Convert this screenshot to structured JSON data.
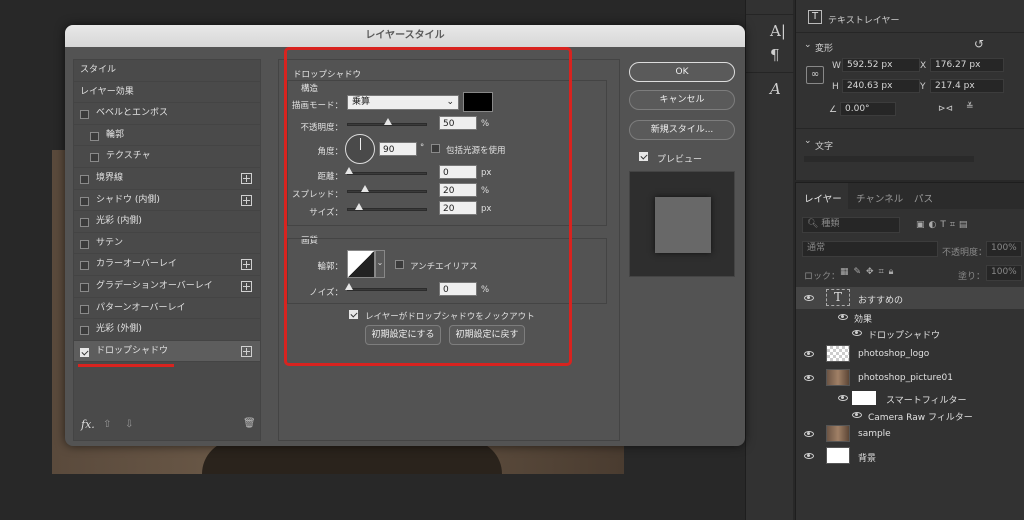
{
  "dialog": {
    "title": "レイヤースタイル",
    "styles": [
      {
        "label": "スタイル",
        "checkbox": false,
        "plus": false,
        "indent": false
      },
      {
        "label": "レイヤー効果",
        "checkbox": false,
        "plus": false,
        "indent": false
      },
      {
        "label": "ベベルとエンボス",
        "checkbox": true,
        "checked": false,
        "plus": false,
        "indent": false
      },
      {
        "label": "輪郭",
        "checkbox": true,
        "checked": false,
        "plus": false,
        "indent": true
      },
      {
        "label": "テクスチャ",
        "checkbox": true,
        "checked": false,
        "plus": false,
        "indent": true
      },
      {
        "label": "境界線",
        "checkbox": true,
        "checked": false,
        "plus": true,
        "indent": false
      },
      {
        "label": "シャドウ (内側)",
        "checkbox": true,
        "checked": false,
        "plus": true,
        "indent": false
      },
      {
        "label": "光彩 (内側)",
        "checkbox": true,
        "checked": false,
        "plus": false,
        "indent": false
      },
      {
        "label": "サテン",
        "checkbox": true,
        "checked": false,
        "plus": false,
        "indent": false
      },
      {
        "label": "カラーオーバーレイ",
        "checkbox": true,
        "checked": false,
        "plus": true,
        "indent": false
      },
      {
        "label": "グラデーションオーバーレイ",
        "checkbox": true,
        "checked": false,
        "plus": true,
        "indent": false
      },
      {
        "label": "パターンオーバーレイ",
        "checkbox": true,
        "checked": false,
        "plus": false,
        "indent": false
      },
      {
        "label": "光彩 (外側)",
        "checkbox": true,
        "checked": false,
        "plus": false,
        "indent": false
      },
      {
        "label": "ドロップシャドウ",
        "checkbox": true,
        "checked": true,
        "plus": true,
        "indent": false,
        "selected": true
      }
    ],
    "footer_fx": "fx.",
    "section_title": "ドロップシャドウ",
    "structure": {
      "title": "構造",
      "blend_mode_label": "描画モード：",
      "blend_mode_value": "乗算",
      "color": "#000000",
      "opacity_label": "不透明度：",
      "opacity_value": "50",
      "opacity_unit": "%",
      "angle_label": "角度：",
      "angle_value": "90",
      "angle_unit": "°",
      "global_light_label": "包括光源を使用",
      "distance_label": "距離：",
      "distance_value": "0",
      "distance_unit": "px",
      "spread_label": "スプレッド：",
      "spread_value": "20",
      "spread_unit": "%",
      "size_label": "サイズ：",
      "size_value": "20",
      "size_unit": "px"
    },
    "quality": {
      "title": "画質",
      "contour_label": "輪郭：",
      "antialias_label": "アンチエイリアス",
      "noise_label": "ノイズ：",
      "noise_value": "0",
      "noise_unit": "%"
    },
    "knockout_label": "レイヤーがドロップシャドウをノックアウト",
    "make_default": "初期設定にする",
    "reset_default": "初期設定に戻す",
    "ok": "OK",
    "cancel": "キャンセル",
    "new_style": "新規スタイル...",
    "preview_label": "プレビュー"
  },
  "properties": {
    "text_layer": "テキストレイヤー",
    "transform": "変形",
    "w_label": "W",
    "w_value": "592.52 px",
    "x_label": "X",
    "x_value": "176.27 px",
    "h_label": "H",
    "h_value": "240.63 px",
    "y_label": "Y",
    "y_value": "217.4 px",
    "angle_value": "0.00°",
    "text_section": "文字"
  },
  "layers_panel": {
    "tabs": [
      "レイヤー",
      "チャンネル",
      "パス"
    ],
    "search_placeholder": "種類",
    "blend": "通常",
    "opacity_label": "不透明度：",
    "opacity_value": "100%",
    "lock_label": "ロック：",
    "fill_label": "塗り：",
    "fill_value": "100%",
    "layers": [
      {
        "name": "おすすめの",
        "kind": "text"
      },
      {
        "name": "効果",
        "kind": "sub"
      },
      {
        "name": "ドロップシャドウ",
        "kind": "sub2"
      },
      {
        "name": "photoshop_logo",
        "kind": "layer"
      },
      {
        "name": "photoshop_picture01",
        "kind": "layer"
      },
      {
        "name": "スマートフィルター",
        "kind": "smart"
      },
      {
        "name": "Camera Raw フィルター",
        "kind": "sub2"
      },
      {
        "name": "sample",
        "kind": "layer"
      },
      {
        "name": "背景",
        "kind": "layer"
      }
    ]
  },
  "colors": {
    "highlight": "#d8231f"
  }
}
